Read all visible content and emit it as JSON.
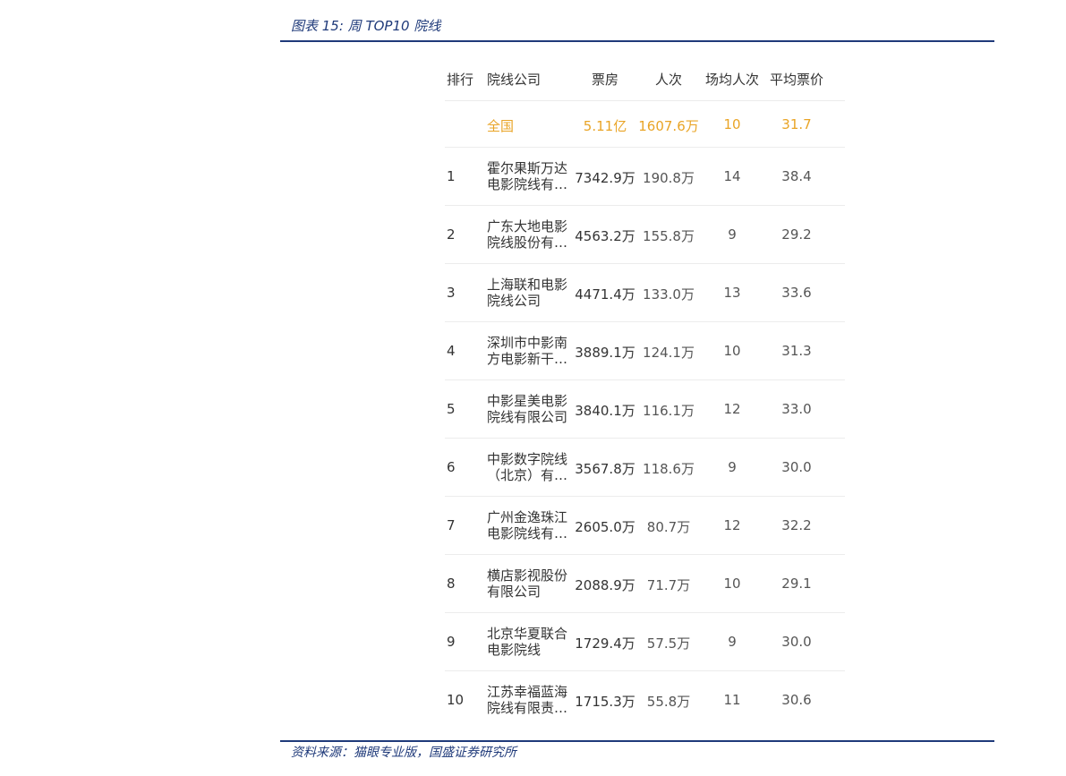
{
  "figure": {
    "title": "图表 15: 周 TOP10 院线",
    "source": "资料来源：猫眼专业版，国盛证券研究所"
  },
  "table": {
    "headers": [
      "排行",
      "院线公司",
      "票房",
      "人次",
      "场均人次",
      "平均票价"
    ],
    "national": {
      "name": "全国",
      "box": "5.11亿",
      "people": "1607.6万",
      "avg_people": "10",
      "avg_price": "31.7"
    },
    "rows": [
      {
        "rank": "1",
        "company_line1": "霍尔果斯万达",
        "company_line2": "电影院线有…",
        "box": "7342.9万",
        "people": "190.8万",
        "avg_people": "14",
        "avg_price": "38.4"
      },
      {
        "rank": "2",
        "company_line1": "广东大地电影",
        "company_line2": "院线股份有…",
        "box": "4563.2万",
        "people": "155.8万",
        "avg_people": "9",
        "avg_price": "29.2"
      },
      {
        "rank": "3",
        "company_line1": "上海联和电影",
        "company_line2": "院线公司",
        "box": "4471.4万",
        "people": "133.0万",
        "avg_people": "13",
        "avg_price": "33.6"
      },
      {
        "rank": "4",
        "company_line1": "深圳市中影南",
        "company_line2": "方电影新干…",
        "box": "3889.1万",
        "people": "124.1万",
        "avg_people": "10",
        "avg_price": "31.3"
      },
      {
        "rank": "5",
        "company_line1": "中影星美电影",
        "company_line2": "院线有限公司",
        "box": "3840.1万",
        "people": "116.1万",
        "avg_people": "12",
        "avg_price": "33.0"
      },
      {
        "rank": "6",
        "company_line1": "中影数字院线",
        "company_line2": "（北京）有…",
        "box": "3567.8万",
        "people": "118.6万",
        "avg_people": "9",
        "avg_price": "30.0"
      },
      {
        "rank": "7",
        "company_line1": "广州金逸珠江",
        "company_line2": "电影院线有…",
        "box": "2605.0万",
        "people": "80.7万",
        "avg_people": "12",
        "avg_price": "32.2"
      },
      {
        "rank": "8",
        "company_line1": "横店影视股份",
        "company_line2": "有限公司",
        "box": "2088.9万",
        "people": "71.7万",
        "avg_people": "10",
        "avg_price": "29.1"
      },
      {
        "rank": "9",
        "company_line1": "北京华夏联合",
        "company_line2": "电影院线",
        "box": "1729.4万",
        "people": "57.5万",
        "avg_people": "9",
        "avg_price": "30.0"
      },
      {
        "rank": "10",
        "company_line1": "江苏幸福蓝海",
        "company_line2": "院线有限责…",
        "box": "1715.3万",
        "people": "55.8万",
        "avg_people": "11",
        "avg_price": "30.6"
      }
    ]
  },
  "colors": {
    "accent_navy": "#1f3a7a",
    "national_highlight": "#e9a426",
    "row_divider": "#ececec"
  }
}
